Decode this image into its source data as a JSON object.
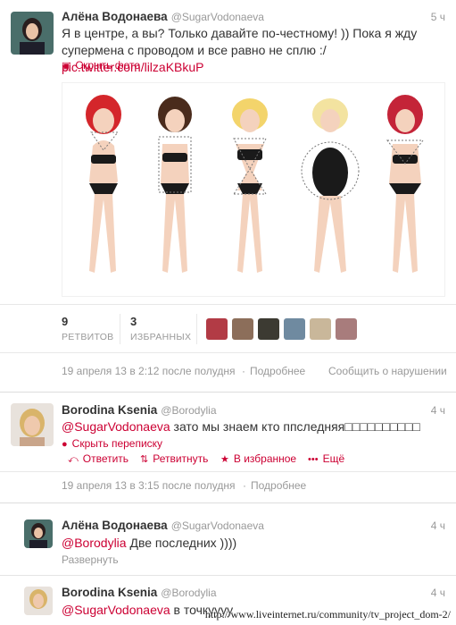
{
  "tweet1": {
    "name": "Алёна Водонаева",
    "handle": "@SugarVodonaeva",
    "time": "5 ч",
    "text_line1": "Я в центре, а вы? Только давайте по-честному! )) Пока я жду",
    "text_line2": "супермена с проводом и все равно не сплю :/",
    "link": "pic.twitter.com/lilzaKBkuP",
    "hide_photo": "Скрыть фото",
    "retweets_count": "9",
    "retweets_label": "РЕТВИТОВ",
    "favorites_count": "3",
    "favorites_label": "ИЗБРАННЫХ",
    "date": "19 апреля 13 в 2:12 после полудня",
    "details": "Подробнее",
    "report": "Сообщить о нарушении"
  },
  "tweet2": {
    "name": "Borodina Ksenia",
    "handle": "@Borodylia",
    "time": "4 ч",
    "mention": "@SugarVodonaeva",
    "text": " зато мы знаем кто ппследняя□□□□□□□□□□",
    "hide_conversation": "Скрыть переписку",
    "reply": "Ответить",
    "retweet": "Ретвитнуть",
    "favorite": "В избранное",
    "more": "Ещё",
    "date": "19 апреля 13 в 3:15 после полудня",
    "details": "Подробнее"
  },
  "tweet3": {
    "name": "Алёна Водонаева",
    "handle": "@SugarVodonaeva",
    "time": "4 ч",
    "mention": "@Borodylia",
    "text": " Две последних ))))",
    "expand": "Развернуть"
  },
  "tweet4": {
    "name": "Borodina Ksenia",
    "handle": "@Borodylia",
    "time": "4 ч",
    "mention": "@SugarVodonaeva",
    "text": " в точкуууу"
  },
  "watermark": "http://www.liveinternet.ru/community/tv_project_dom-2/",
  "colors": {
    "accent": "#cc0033",
    "muted": "#999999",
    "text": "#333333"
  }
}
